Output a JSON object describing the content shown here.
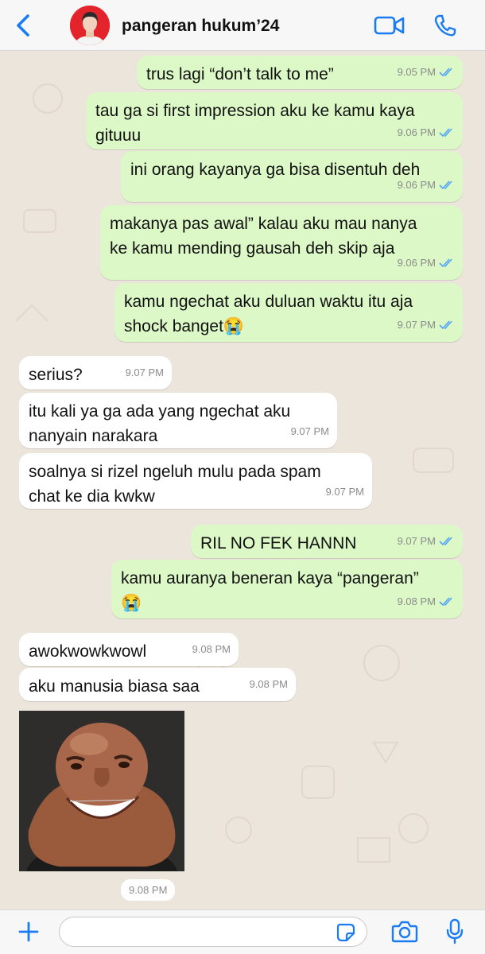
{
  "header": {
    "back_icon": "chevron-left-icon",
    "contact_name": "pangeran hukum’24",
    "video_icon": "video-camera-icon",
    "call_icon": "phone-icon",
    "accent": "#1a7cf5"
  },
  "messages": [
    {
      "dir": "out",
      "text": "trus lagi “don’t talk to me”",
      "time": "9.05 PM"
    },
    {
      "dir": "out",
      "text": "tau ga si first impression aku ke kamu kaya\ngituuu",
      "time": "9.06 PM"
    },
    {
      "dir": "out",
      "text": "ini orang kayanya ga bisa disentuh deh",
      "time": "9.06 PM"
    },
    {
      "dir": "out",
      "text": "makanya pas awal” kalau aku mau nanya\nke kamu mending gausah deh skip aja",
      "time": "9.06 PM"
    },
    {
      "dir": "out",
      "text": "kamu ngechat aku duluan waktu itu aja\nshock banget😭",
      "time": "9.07 PM"
    },
    {
      "dir": "in",
      "text": "serius?",
      "time": "9.07 PM"
    },
    {
      "dir": "in",
      "text": "itu kali ya ga ada yang ngechat aku\nnanyain narakara",
      "time": "9.07 PM"
    },
    {
      "dir": "in",
      "text": "soalnya si rizel ngeluh mulu pada spam\nchat ke dia kwkw",
      "time": "9.07 PM"
    },
    {
      "dir": "out",
      "text": "RIL NO FEK HANNN",
      "time": "9.07 PM"
    },
    {
      "dir": "out",
      "text": "kamu auranya beneran kaya “pangeran”\n😭",
      "time": "9.08 PM"
    },
    {
      "dir": "in",
      "text": "awokwowkwowl",
      "time": "9.08 PM"
    },
    {
      "dir": "in",
      "text": "aku manusia biasa saa",
      "time": "9.08 PM"
    }
  ],
  "image_message": {
    "time": "9.08 PM"
  },
  "composer": {
    "placeholder": "",
    "add_icon": "plus-icon",
    "sticker_icon": "sticker-icon",
    "camera_icon": "camera-icon",
    "mic_icon": "microphone-icon"
  },
  "colors": {
    "outgoing": "#dcf8c6",
    "incoming": "#ffffff",
    "wallpaper": "#ece5dc",
    "read_ticks": "#4fa3f7"
  }
}
